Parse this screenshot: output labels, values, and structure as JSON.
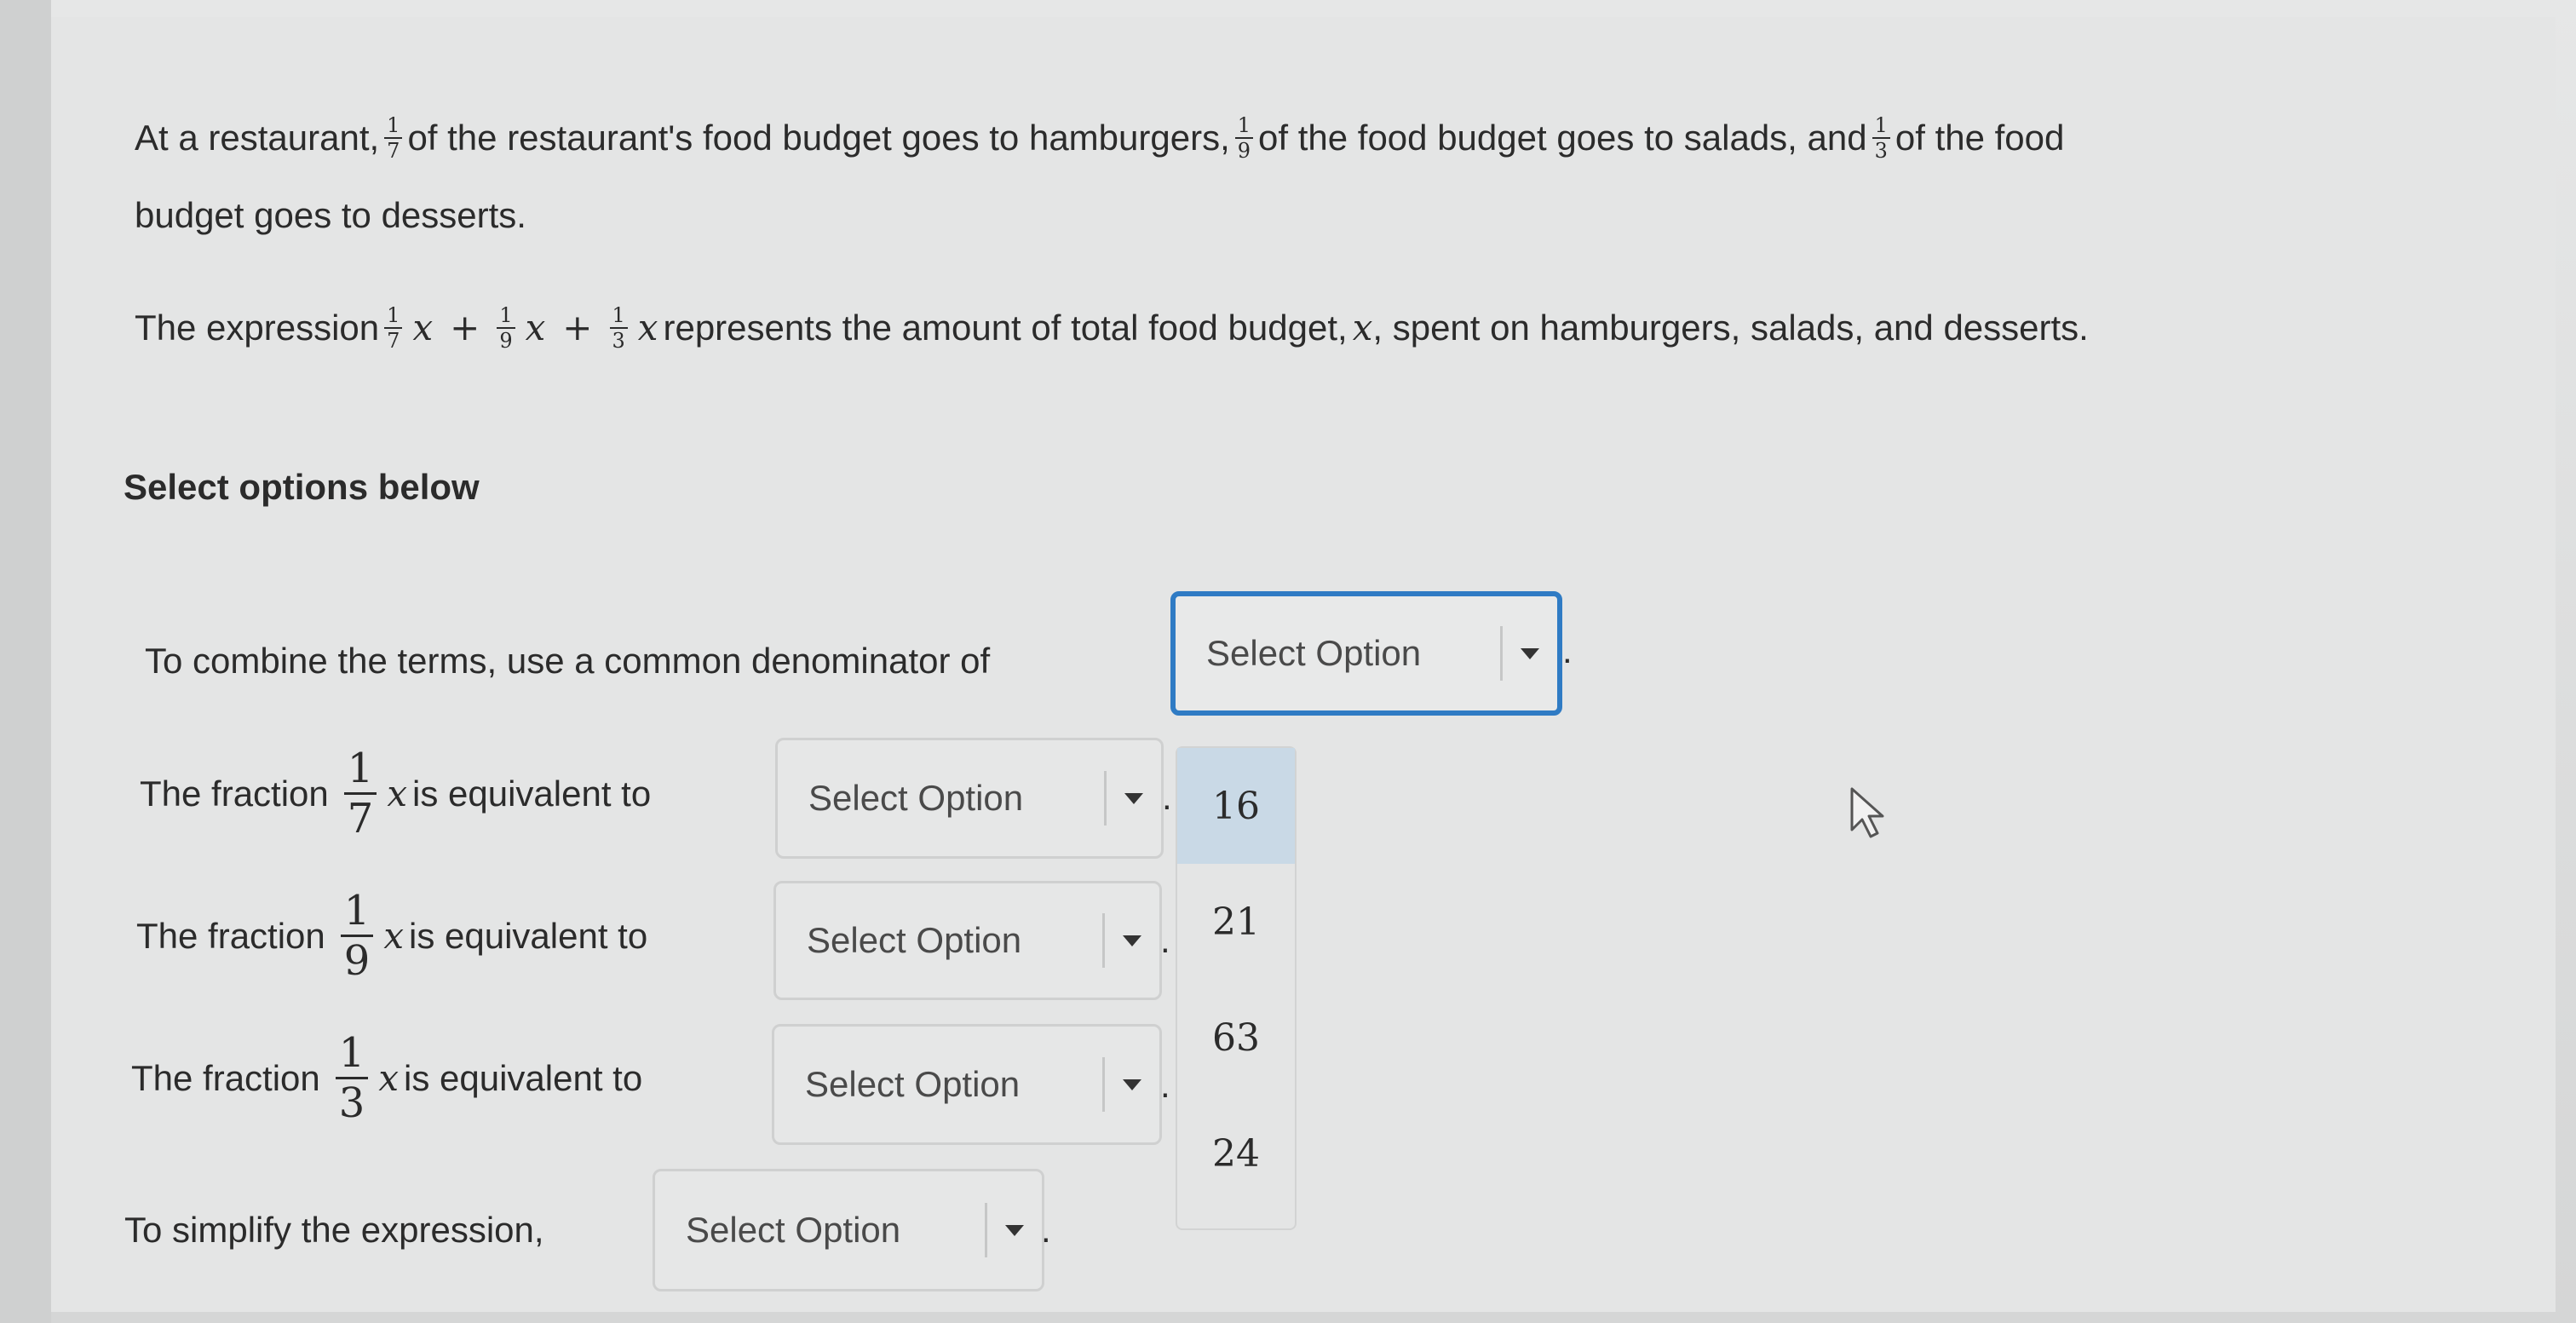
{
  "question": {
    "p1_a": "At a restaurant,",
    "f1_num": "1",
    "f1_den": "7",
    "p1_b": "of the restaurant's food budget goes to hamburgers,",
    "f2_num": "1",
    "f2_den": "9",
    "p1_c": "of the food budget goes to salads, and",
    "f3_num": "1",
    "f3_den": "3",
    "p1_d": "of the food",
    "p1_line2": "budget goes to desserts.",
    "p2_a": "The expression",
    "var_x": "x",
    "plus": "+",
    "p2_b": "represents the amount of total food budget,",
    "p2_c": ", spent on hamburgers, salads, and desserts."
  },
  "section_heading": "Select options below",
  "rows": [
    {
      "prefix": "To combine the terms, use a common denominator of",
      "select": "Select Option",
      "suffix": "."
    },
    {
      "prefix": "The fraction",
      "num": "1",
      "den": "7",
      "var": "x",
      "middle": "is equivalent to",
      "select": "Select Option",
      "suffix": "."
    },
    {
      "prefix": "The fraction",
      "num": "1",
      "den": "9",
      "var": "x",
      "middle": "is equivalent to",
      "select": "Select Option",
      "suffix": "."
    },
    {
      "prefix": "The fraction",
      "num": "1",
      "den": "3",
      "var": "x",
      "middle": "is equivalent to",
      "select": "Select Option",
      "suffix": "."
    },
    {
      "prefix": "To simplify the expression,",
      "select": "Select Option",
      "suffix": "."
    }
  ],
  "dropdown_options": [
    "16",
    "21",
    "63",
    "24"
  ],
  "highlighted_option": "16",
  "colors": {
    "focus_border": "#2f7bc4",
    "highlight": "#c9d9e6"
  }
}
